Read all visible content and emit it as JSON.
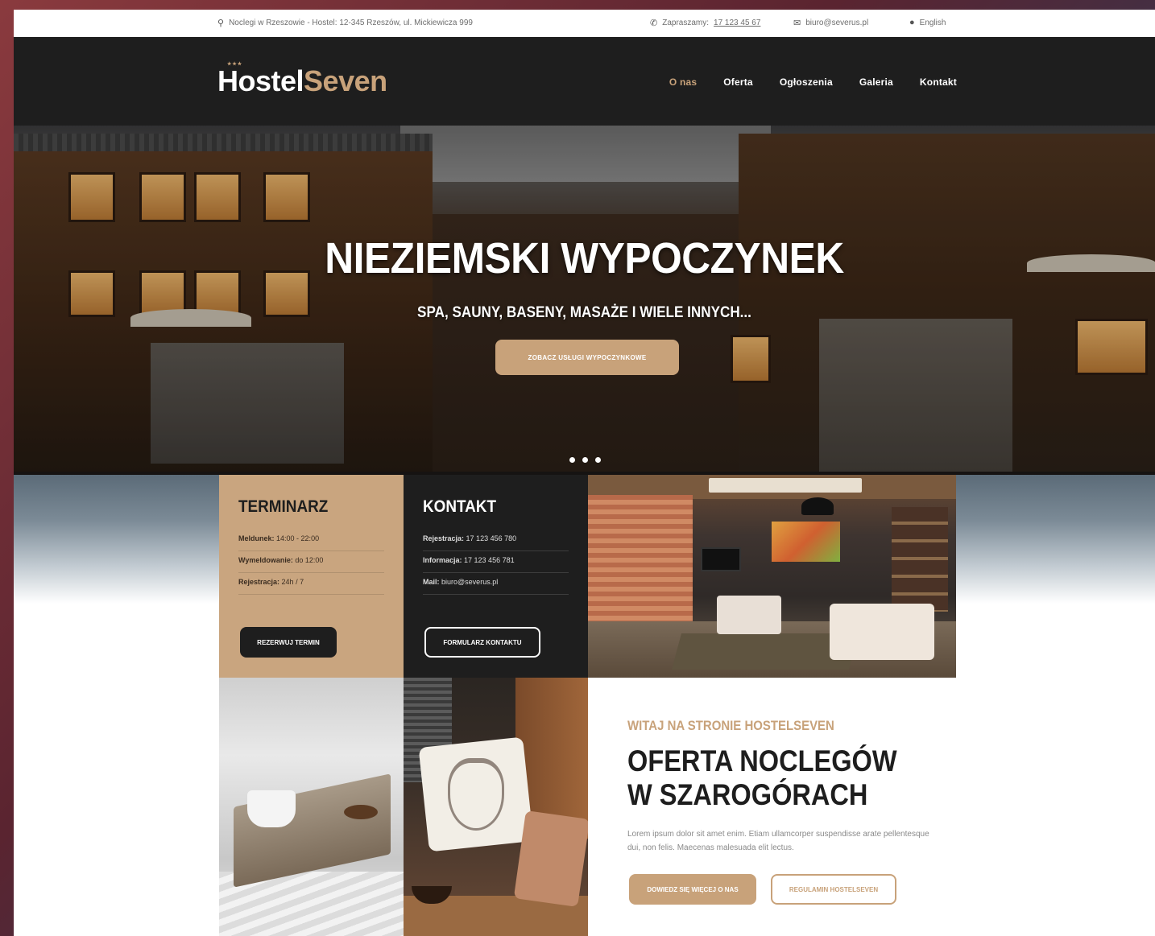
{
  "topbar": {
    "address": "Noclegi w Rzeszowie - Hostel: 12-345 Rzeszów, ul. Mickiewicza 999",
    "phone_label": "Zapraszamy:",
    "phone_number": "17 123 45 67",
    "email": "biuro@severus.pl",
    "language": "English",
    "icons": {
      "address": "map-pin-icon",
      "phone": "phone-icon",
      "email": "envelope-icon",
      "language": "globe-icon"
    }
  },
  "header": {
    "logo_part1": "Hostel",
    "logo_part2": "Seven",
    "logo_stars": "★★★",
    "nav": [
      "O nas",
      "Oferta",
      "Ogłoszenia",
      "Galeria",
      "Kontakt"
    ],
    "active_nav": "O nas"
  },
  "hero": {
    "title": "NIEZIEMSKI WYPOCZYNEK",
    "subtitle": "SPA, SAUNY, BASENY, MASAŻE I WIELE INNYCH...",
    "cta": "ZOBACZ USŁUGI WYPOCZYNKOWE",
    "slides_total": 3
  },
  "terminarz": {
    "title": "TERMINARZ",
    "rows": [
      {
        "label": "Meldunek:",
        "value": "14:00 - 22:00"
      },
      {
        "label": "Wymeldowanie:",
        "value": "do 12:00"
      },
      {
        "label": "Rejestracja:",
        "value": "24h / 7"
      }
    ],
    "button": "REZERWUJ TERMIN"
  },
  "kontakt": {
    "title": "KONTAKT",
    "rows": [
      {
        "label": "Rejestracja:",
        "value": "17 123 456 780"
      },
      {
        "label": "Informacja:",
        "value": "17 123 456 781"
      },
      {
        "label": "Mail:",
        "value": "biuro@severus.pl"
      }
    ],
    "button": "FORMULARZ KONTAKTU"
  },
  "welcome": {
    "kicker": "WITAJ NA STRONIE HOSTELSEVEN",
    "title_line1": "OFERTA NOCLEGÓW",
    "title_line2": "W SZAROGÓRACH",
    "text": "Lorem ipsum dolor sit amet enim. Etiam ullamcorper suspendisse arate pellentesque dui, non felis. Maecenas malesuada elit lectus.",
    "button_more": "DOWIEDZ SIĘ WIĘCEJ O NAS",
    "button_rules": "REGULAMIN HOSTELSEVEN"
  },
  "colors": {
    "accent": "#c8a27a",
    "dark": "#1e1e1e",
    "white": "#ffffff"
  }
}
